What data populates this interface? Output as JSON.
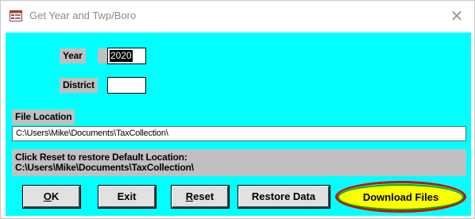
{
  "window": {
    "title": "Get Year and Twp/Boro",
    "close_glyph": "✕"
  },
  "form": {
    "year_label": "Year",
    "year_value": "2020",
    "district_label": "District",
    "district_value": "",
    "file_location_label": "File Location",
    "file_location_value": "C:\\Users\\Mike\\Documents\\TaxCollection\\",
    "info_line1": "Click Reset to restore Default Location:",
    "info_line2": "C:\\Users\\Mike\\Documents\\TaxCollection\\"
  },
  "buttons": {
    "ok_mnemonic": "O",
    "ok_rest": "K",
    "exit": "Exit",
    "reset_mnemonic": "R",
    "reset_rest": "eset",
    "restore_data": "Restore Data",
    "download_files": "Download Files"
  },
  "colors": {
    "client_background": "#00ffff",
    "label_background": "#c0c0c0",
    "download_highlight": "#ffff00",
    "download_ring_outer": "#e00000",
    "download_ring_inner": "#00b000"
  },
  "icons": {
    "title_icon": "form-icon",
    "close_icon": "close-icon"
  }
}
